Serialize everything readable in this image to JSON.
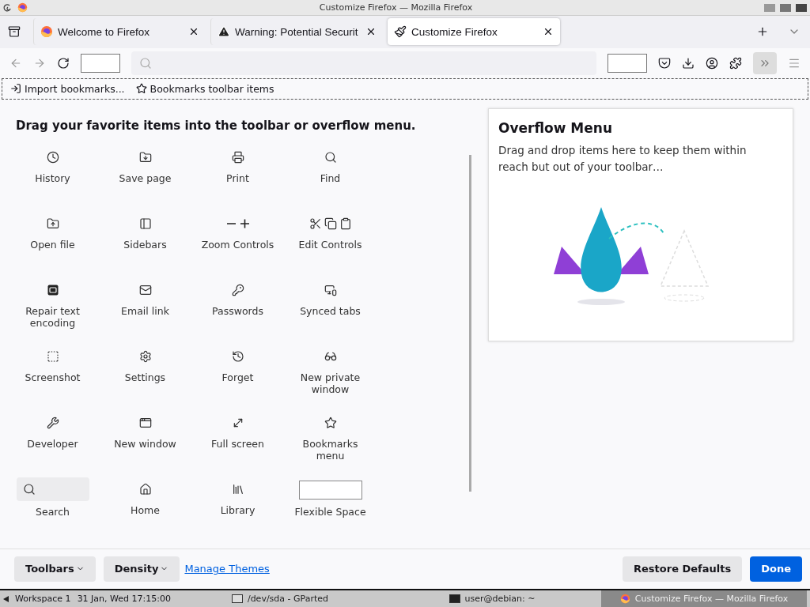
{
  "window": {
    "title": "Customize Firefox — Mozilla Firefox"
  },
  "tabs": [
    {
      "label": "Welcome to Firefox",
      "kind": "firefox",
      "selected": false
    },
    {
      "label": "Warning: Potential Securit",
      "kind": "warning",
      "selected": false
    },
    {
      "label": "Customize Firefox",
      "kind": "brush",
      "selected": true
    }
  ],
  "bookmarks_toolbar": [
    {
      "label": "Import bookmarks...",
      "kind": "import"
    },
    {
      "label": "Bookmarks toolbar items",
      "kind": "star"
    }
  ],
  "palette": {
    "heading": "Drag your favorite items into the toolbar or overflow menu.",
    "items": [
      {
        "label": "History",
        "kind": "history"
      },
      {
        "label": "Save page",
        "kind": "save"
      },
      {
        "label": "Print",
        "kind": "print"
      },
      {
        "label": "Find",
        "kind": "find"
      },
      {
        "label": "Open file",
        "kind": "open"
      },
      {
        "label": "Sidebars",
        "kind": "sidebars"
      },
      {
        "label": "Zoom Controls",
        "kind": "zoom"
      },
      {
        "label": "Edit Controls",
        "kind": "edit"
      },
      {
        "label": "Repair text encoding",
        "kind": "encoding"
      },
      {
        "label": "Email link",
        "kind": "email"
      },
      {
        "label": "Passwords",
        "kind": "passwords"
      },
      {
        "label": "Synced tabs",
        "kind": "synced"
      },
      {
        "label": "Screenshot",
        "kind": "screenshot"
      },
      {
        "label": "Settings",
        "kind": "settings"
      },
      {
        "label": "Forget",
        "kind": "forget"
      },
      {
        "label": "New private window",
        "kind": "private"
      },
      {
        "label": "Developer",
        "kind": "developer"
      },
      {
        "label": "New window",
        "kind": "window"
      },
      {
        "label": "Full screen",
        "kind": "fullscreen"
      },
      {
        "label": "Bookmarks menu",
        "kind": "bookmarks"
      },
      {
        "label": "Search",
        "kind": "search"
      },
      {
        "label": "Home",
        "kind": "home"
      },
      {
        "label": "Library",
        "kind": "library"
      },
      {
        "label": "Flexible Space",
        "kind": "spacer"
      }
    ]
  },
  "overflow_panel": {
    "title": "Overflow Menu",
    "text": "Drag and drop items here to keep them within reach but out of your toolbar…"
  },
  "footer": {
    "toolbars": "Toolbars",
    "density": "Density",
    "manage_themes": "Manage Themes",
    "restore": "Restore Defaults",
    "done": "Done"
  },
  "taskbar": {
    "workspace": "Workspace 1",
    "datetime": "31 Jan, Wed 17:15:00",
    "tasks": [
      {
        "label": "/dev/sda - GParted",
        "kind": "gparted"
      },
      {
        "label": "user@debian: ~",
        "kind": "terminal"
      },
      {
        "label": "Customize Firefox — Mozilla Firefox",
        "kind": "firefox"
      }
    ]
  }
}
